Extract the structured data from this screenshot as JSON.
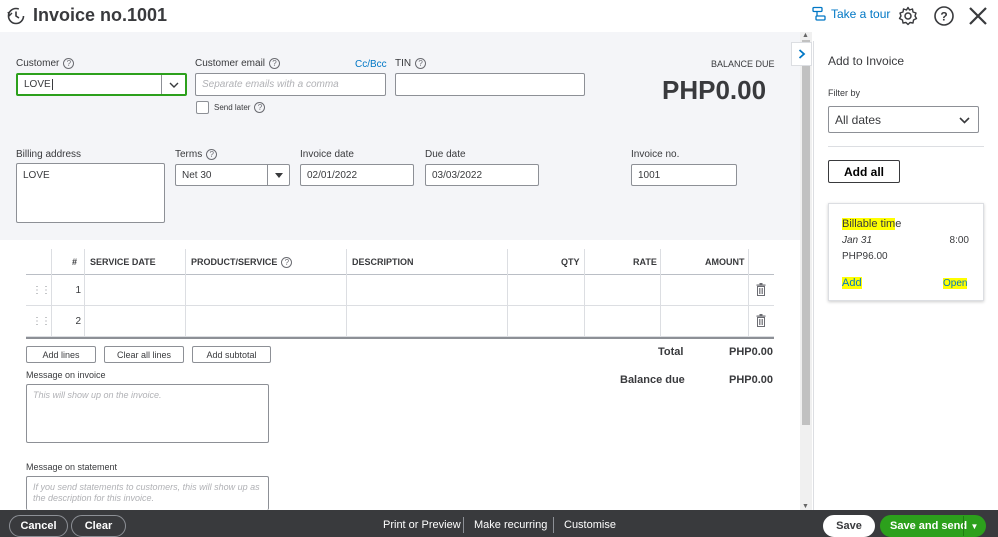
{
  "header": {
    "title": "Invoice no.1001",
    "take_tour": "Take a tour"
  },
  "customer": {
    "label": "Customer",
    "value": "LOVE",
    "email_label": "Customer email",
    "email_placeholder": "Separate emails with a comma",
    "ccbcc": "Cc/Bcc",
    "tin_label": "TIN",
    "send_later": "Send later"
  },
  "balance": {
    "label": "BALANCE DUE",
    "amount": "PHP0.00"
  },
  "billing": {
    "label": "Billing address",
    "value": "LOVE"
  },
  "terms": {
    "label": "Terms",
    "value": "Net 30"
  },
  "invoice_date": {
    "label": "Invoice date",
    "value": "02/01/2022"
  },
  "due_date": {
    "label": "Due date",
    "value": "03/03/2022"
  },
  "invoice_no": {
    "label": "Invoice no.",
    "value": "1001"
  },
  "table": {
    "columns": [
      "#",
      "SERVICE DATE",
      "PRODUCT/SERVICE",
      "DESCRIPTION",
      "QTY",
      "RATE",
      "AMOUNT"
    ],
    "rows": [
      {
        "num": "1"
      },
      {
        "num": "2"
      }
    ]
  },
  "line_buttons": {
    "add_lines": "Add lines",
    "clear_all": "Clear all lines",
    "add_subtotal": "Add subtotal"
  },
  "totals": {
    "total_label": "Total",
    "total_value": "PHP0.00",
    "balance_label": "Balance due",
    "balance_value": "PHP0.00"
  },
  "message_invoice": {
    "label": "Message on invoice",
    "placeholder": "This will show up on the invoice."
  },
  "message_statement": {
    "label": "Message on statement",
    "placeholder": "If you send statements to customers, this will show up as the description for this invoice."
  },
  "panel": {
    "title": "Add to Invoice",
    "filter_label": "Filter by",
    "filter_value": "All dates",
    "add_all": "Add all",
    "card": {
      "title_hl": "Billable tim",
      "title_rest": "e",
      "date": "Jan 31",
      "time": "8:00",
      "amount": "PHP96.00",
      "add": "Add",
      "open": "Open"
    }
  },
  "footer": {
    "cancel": "Cancel",
    "clear": "Clear",
    "print_preview": "Print or Preview",
    "make_recurring": "Make recurring",
    "customise": "Customise",
    "save": "Save",
    "save_send": "Save and send"
  },
  "colors": {
    "green": "#2ca01c",
    "blue_link": "#0077c5",
    "footer_bg": "#393a3d",
    "highlight": "#ffff00"
  }
}
